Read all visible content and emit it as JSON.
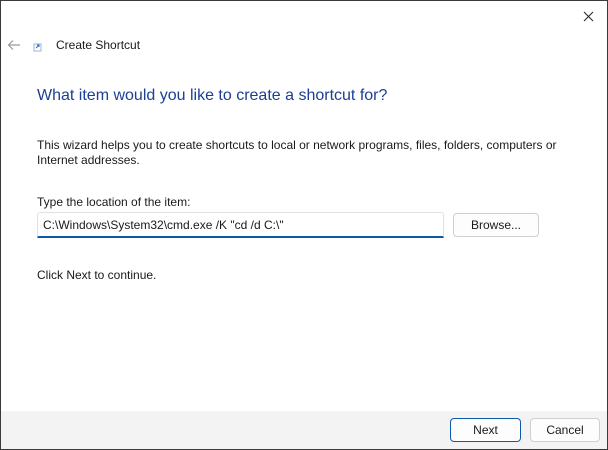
{
  "window": {
    "title": "Create Shortcut",
    "close_glyph": "✕",
    "back_glyph": "←"
  },
  "icons": {
    "back": "back-arrow-icon",
    "app": "shortcut-app-icon",
    "close": "close-icon"
  },
  "content": {
    "heading": "What item would you like to create a shortcut for?",
    "description": "This wizard helps you to create shortcuts to local or network programs, files, folders, computers or Internet addresses.",
    "location_label": "Type the location of the item:",
    "location_value": "C:\\Windows\\System32\\cmd.exe /K \"cd /d C:\\\"",
    "browse_label": "Browse...",
    "continue_text": "Click Next to continue."
  },
  "footer": {
    "next_label": "Next",
    "cancel_label": "Cancel"
  },
  "colors": {
    "heading": "#1c3f94",
    "accent": "#0f5aa8",
    "footer_bg": "#f3f3f3"
  }
}
